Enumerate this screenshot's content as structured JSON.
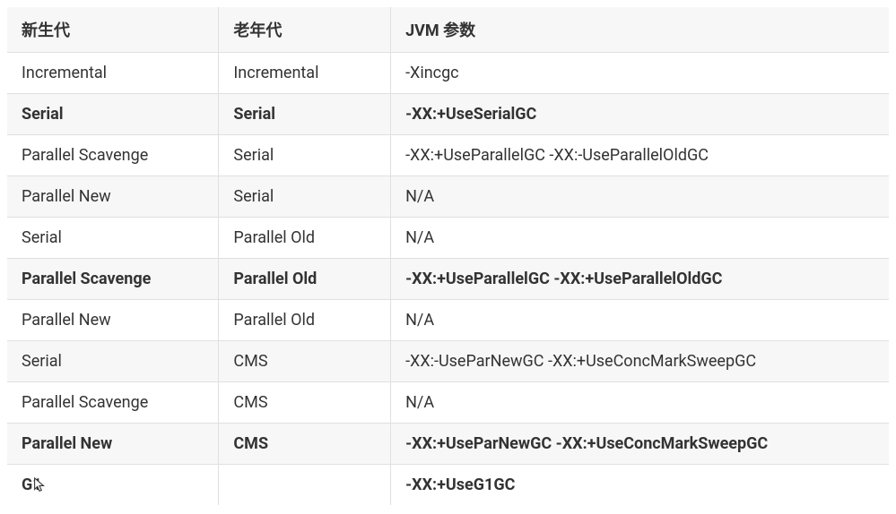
{
  "table": {
    "headers": [
      "新生代",
      "老年代",
      "JVM 参数"
    ],
    "rows": [
      {
        "cells": [
          "Incremental",
          "Incremental",
          "-Xincgc"
        ],
        "bold": false
      },
      {
        "cells": [
          "Serial",
          "Serial",
          "-XX:+UseSerialGC"
        ],
        "bold": true
      },
      {
        "cells": [
          "Parallel Scavenge",
          "Serial",
          "-XX:+UseParallelGC -XX:-UseParallelOldGC"
        ],
        "bold": false
      },
      {
        "cells": [
          "Parallel New",
          "Serial",
          "N/A"
        ],
        "bold": false
      },
      {
        "cells": [
          "Serial",
          "Parallel Old",
          "N/A"
        ],
        "bold": false
      },
      {
        "cells": [
          "Parallel Scavenge",
          "Parallel Old",
          "-XX:+UseParallelGC -XX:+UseParallelOldGC"
        ],
        "bold": true
      },
      {
        "cells": [
          "Parallel New",
          "Parallel Old",
          "N/A"
        ],
        "bold": false
      },
      {
        "cells": [
          "Serial",
          "CMS",
          "-XX:-UseParNewGC -XX:+UseConcMarkSweepGC"
        ],
        "bold": false
      },
      {
        "cells": [
          "Parallel Scavenge",
          "CMS",
          "N/A"
        ],
        "bold": false
      },
      {
        "cells": [
          "Parallel New",
          "CMS",
          "-XX:+UseParNewGC -XX:+UseConcMarkSweepGC"
        ],
        "bold": true
      },
      {
        "cells": [
          "G1",
          "",
          "-XX:+UseG1GC"
        ],
        "bold": true,
        "cursor": true
      }
    ]
  }
}
